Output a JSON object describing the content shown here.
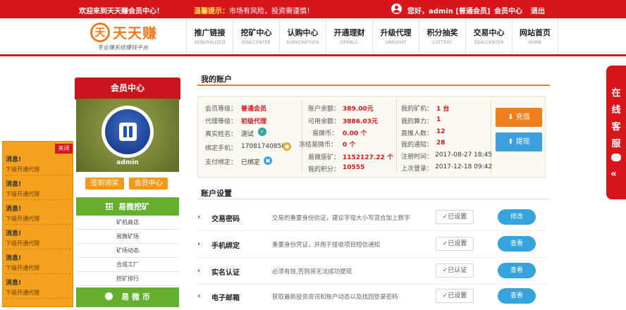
{
  "topbar": {
    "welcome": "欢迎来到天天赚会员中心！",
    "tip_label": "温馨提示：",
    "tip_text": "市场有风险，投资需谨慎！",
    "greeting": "您好，admin [普通会员]",
    "member_center": "会员中心",
    "logout": "退出"
  },
  "logo": {
    "badge": "天",
    "name": "天天赚",
    "slogan": "专业赚系统赚钱平台"
  },
  "nav": [
    {
      "cn": "推广链接",
      "en": "GENERALIZED"
    },
    {
      "cn": "挖矿中心",
      "en": "MINECENTER"
    },
    {
      "cn": "认购中心",
      "en": "SUBSCRIPTION"
    },
    {
      "cn": "开通理财",
      "en": "OPENLC"
    },
    {
      "cn": "升级代理",
      "en": "UPAGENT"
    },
    {
      "cn": "积分抽奖",
      "en": "LOTTERY"
    },
    {
      "cn": "交易中心",
      "en": "DEALCENTER"
    },
    {
      "cn": "网站首页",
      "en": "HOME"
    }
  ],
  "news": {
    "close": "关闭",
    "items": [
      {
        "title": "消息!",
        "sub": "下级开通代理"
      },
      {
        "title": "消息!",
        "sub": "下级开通代理"
      },
      {
        "title": "消息!",
        "sub": "下级开通代理"
      },
      {
        "title": "消息!",
        "sub": "下级开通代理"
      },
      {
        "title": "消息!",
        "sub": "下级开通代理"
      },
      {
        "title": "消息!",
        "sub": "下级开通代理"
      }
    ]
  },
  "member": {
    "ribbon": "会员中心",
    "username": "admin",
    "sign_btn": "签到领奖",
    "center_btn": "会员中心",
    "mining_head": "易微挖矿",
    "mining_links": [
      "矿机商店",
      "易微矿场",
      "矿场动态",
      "合成工厂",
      "挖矿排行"
    ],
    "coin_head": "易 微 币"
  },
  "account": {
    "title": "我的账户",
    "col1": [
      {
        "label": "会员等级：",
        "value": "普通会员"
      },
      {
        "label": "代理等级：",
        "value": "初级代理"
      },
      {
        "label": "真实姓名：",
        "value": "测试"
      },
      {
        "label": "绑定手机：",
        "value": "17081740850"
      },
      {
        "label": "支付绑定：",
        "value": "已绑定"
      }
    ],
    "col2": [
      {
        "label": "账户余额：",
        "value": "389.00元"
      },
      {
        "label": "可用余额：",
        "value": "3886.03元"
      },
      {
        "label": "易微币：",
        "value": "0.00 个"
      },
      {
        "label": "冻结易微币：",
        "value": "0 个"
      },
      {
        "label": "易微原矿：",
        "value": "1152127.22 个"
      },
      {
        "label": "我的积分：",
        "value": "10555"
      }
    ],
    "col3": [
      {
        "label": "我的矿机：",
        "value": "1 台"
      },
      {
        "label": "我的算力：",
        "value": "1"
      },
      {
        "label": "直推人数：",
        "value": "12"
      },
      {
        "label": "我的通知：",
        "value": "28"
      },
      {
        "label": "注册时间：",
        "value": "2017-08-27 18:45"
      },
      {
        "label": "上次登录：",
        "value": "2017-12-18 09:42"
      }
    ],
    "recharge": "充值",
    "withdraw": "提现"
  },
  "settings": {
    "title": "账户设置",
    "rows": [
      {
        "name": "交易密码",
        "desc": "交易的重要身份验证，建议字母大小写混合加上数字",
        "status": "已设置",
        "action": "修改"
      },
      {
        "name": "手机绑定",
        "desc": "重要身份凭证，并用于接收项目短信通知",
        "status": "已设置",
        "action": "查看"
      },
      {
        "name": "实名认证",
        "desc": "必须有效,否则将无法成功提现",
        "status": "已认证",
        "action": "查看"
      },
      {
        "name": "电子邮箱",
        "desc": "获取最新投资资讯和账户动态以及找回登录密码",
        "status": "已设置",
        "action": "查看"
      }
    ]
  },
  "cs_tab": {
    "text": "在线客服"
  },
  "colors": {
    "brand_red": "#d6161b",
    "accent_orange": "#ee7d22",
    "green": "#64b02e",
    "blue": "#35a3dc"
  }
}
